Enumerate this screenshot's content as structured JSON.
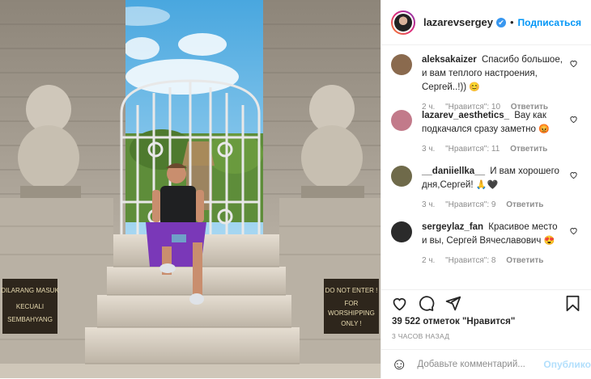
{
  "post": {
    "image_alt": "Man sitting on temple stairs in front of white iron gate",
    "signs": {
      "left": [
        "DILARANG MASUK",
        "KECUALI",
        "SEMBAHYANG"
      ],
      "right": [
        "DO NOT ENTER !",
        "FOR",
        "WORSHIPPING",
        "ONLY !"
      ]
    }
  },
  "header": {
    "username": "lazarevsergey",
    "verified_glyph": "✔",
    "separator": "•",
    "follow_label": "Подписаться"
  },
  "comments": [
    {
      "user": "aleksakaizer",
      "text": "Спасибо большое, и вам теплого настроения, Сергей..!))",
      "emoji": "😊",
      "age": "2 ч.",
      "likes": "\"Нравится\": 10",
      "reply": "Ответить",
      "avatar_color": "#8a6a4e"
    },
    {
      "user": "lazarev_aesthetics_",
      "text": "Вау как подкачался сразу заметно",
      "emoji": "😡",
      "age": "3 ч.",
      "likes": "\"Нравится\": 11",
      "reply": "Ответить",
      "avatar_color": "#c27a8a"
    },
    {
      "user": "__daniiellka__",
      "text": "И вам хорошего дня,Сергей!",
      "emoji": "🙏🖤",
      "age": "3 ч.",
      "likes": "\"Нравится\": 9",
      "reply": "Ответить",
      "avatar_color": "#6f6a4a"
    },
    {
      "user": "sergeylaz_fan",
      "text": "Красивое место и вы, Сергей Вячеславович",
      "emoji": "😍",
      "age": "2 ч.",
      "likes": "\"Нравится\": 8",
      "reply": "Ответить",
      "avatar_color": "#2b2b2b"
    }
  ],
  "actions": {
    "likes_text": "39 522 отметок \"Нравится\"",
    "time_ago": "3 ЧАСОВ НАЗАД"
  },
  "add_comment": {
    "smile_glyph": "☺",
    "placeholder": "Добавьте комментарий...",
    "publish_label": "Опубликовать"
  },
  "colors": {
    "accent": "#0095f6",
    "muted": "#8e8e8e",
    "text": "#262626"
  }
}
